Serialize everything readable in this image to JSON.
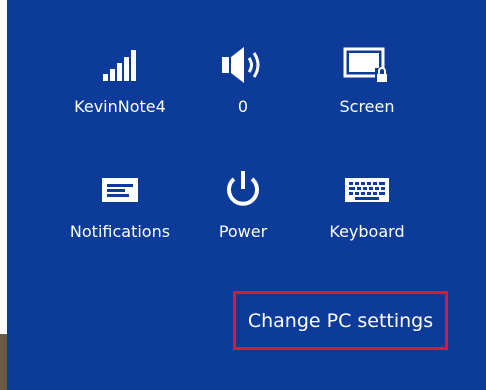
{
  "settings_tiles": [
    {
      "label": "KevinNote4",
      "icon": "wifi-signal-icon"
    },
    {
      "label": "0",
      "icon": "volume-icon"
    },
    {
      "label": "Screen",
      "icon": "screen-lock-icon"
    },
    {
      "label": "Notifications",
      "icon": "notifications-icon"
    },
    {
      "label": "Power",
      "icon": "power-icon"
    },
    {
      "label": "Keyboard",
      "icon": "keyboard-icon"
    }
  ],
  "change_pc_settings": {
    "label": "Change PC settings",
    "highlight_color": "#e01b28"
  },
  "colors": {
    "panel_background": "#0c3b9a",
    "foreground": "#ffffff"
  }
}
